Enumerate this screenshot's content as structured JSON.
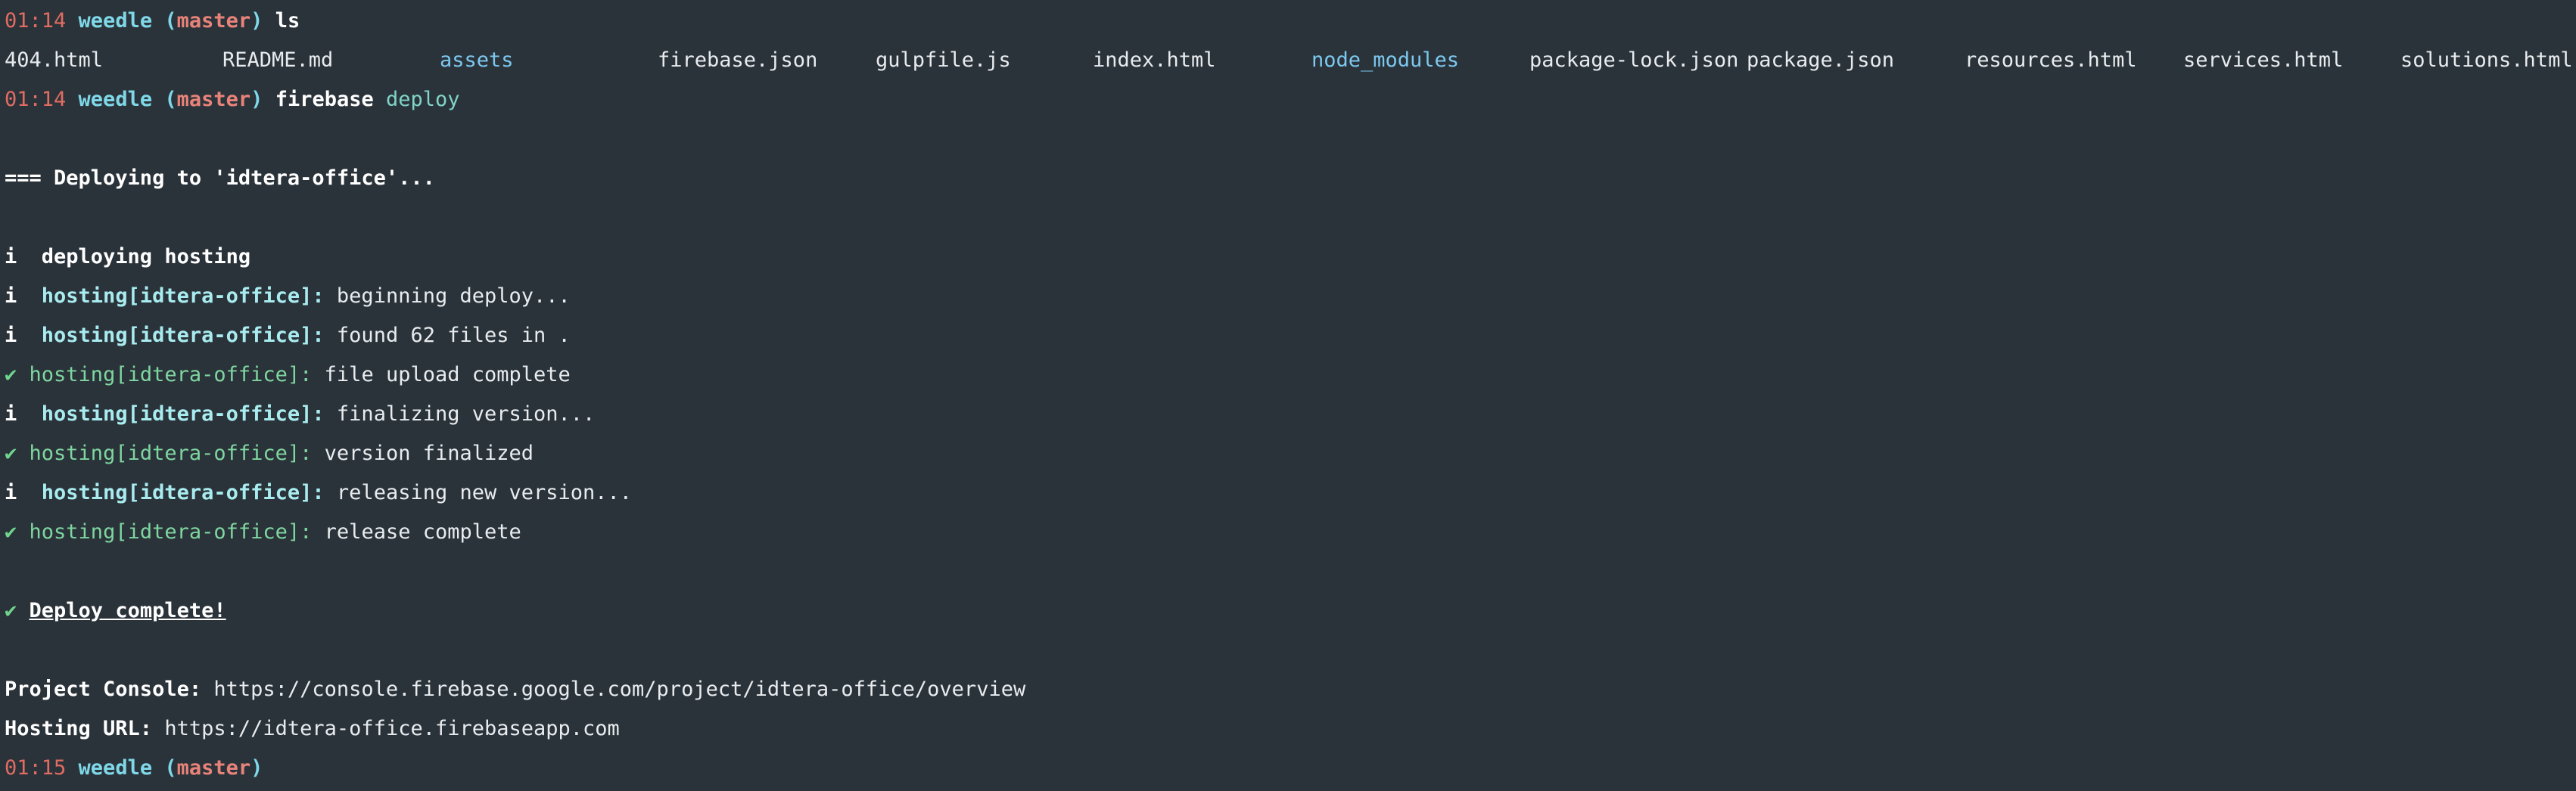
{
  "colors": {
    "background": "#2b333a",
    "prompt_time": "#e06c62",
    "prompt_user": "#7fd8e8",
    "prompt_branch": "#e8837a",
    "directory": "#7cc8f0",
    "success": "#6fd48e",
    "hosting_label": "#a8ecf0"
  },
  "prompt1": {
    "time": "01:14",
    "user": "weedle",
    "open": "(",
    "branch": "master",
    "close": ")",
    "cmd": "ls",
    "arg": ""
  },
  "ls": {
    "entries": [
      "404.html",
      "README.md",
      "assets",
      "firebase.json",
      "gulpfile.js",
      "index.html",
      "node_modules",
      "package-lock.json",
      "package.json",
      "resources.html",
      "services.html",
      "solutions.html"
    ]
  },
  "prompt2": {
    "time": "01:14",
    "user": "weedle",
    "open": "(",
    "branch": "master",
    "close": ")",
    "cmd": "firebase",
    "arg": "deploy"
  },
  "deploy": {
    "header": "=== Deploying to 'idtera-office'...",
    "deploying_prefix": "i  deploying ",
    "deploying_target": "hosting",
    "steps": [
      {
        "mark": "i",
        "label": "hosting[idtera-office]:",
        "msg": "beginning deploy..."
      },
      {
        "mark": "i",
        "label": "hosting[idtera-office]:",
        "msg": "found 62 files in ."
      },
      {
        "mark": "✔",
        "label": "hosting[idtera-office]:",
        "msg": "file upload complete"
      },
      {
        "mark": "i",
        "label": "hosting[idtera-office]:",
        "msg": "finalizing version..."
      },
      {
        "mark": "✔",
        "label": "hosting[idtera-office]:",
        "msg": "version finalized"
      },
      {
        "mark": "i",
        "label": "hosting[idtera-office]:",
        "msg": "releasing new version..."
      },
      {
        "mark": "✔",
        "label": "hosting[idtera-office]:",
        "msg": "release complete"
      }
    ],
    "complete_mark": "✔",
    "complete_text": "Deploy complete!",
    "console_label": "Project Console:",
    "console_url": "https://console.firebase.google.com/project/idtera-office/overview",
    "hosting_label": "Hosting URL:",
    "hosting_url": "https://idtera-office.firebaseapp.com"
  },
  "prompt3": {
    "time": "01:15",
    "user": "weedle",
    "open": "(",
    "branch": "master",
    "close": ")"
  }
}
